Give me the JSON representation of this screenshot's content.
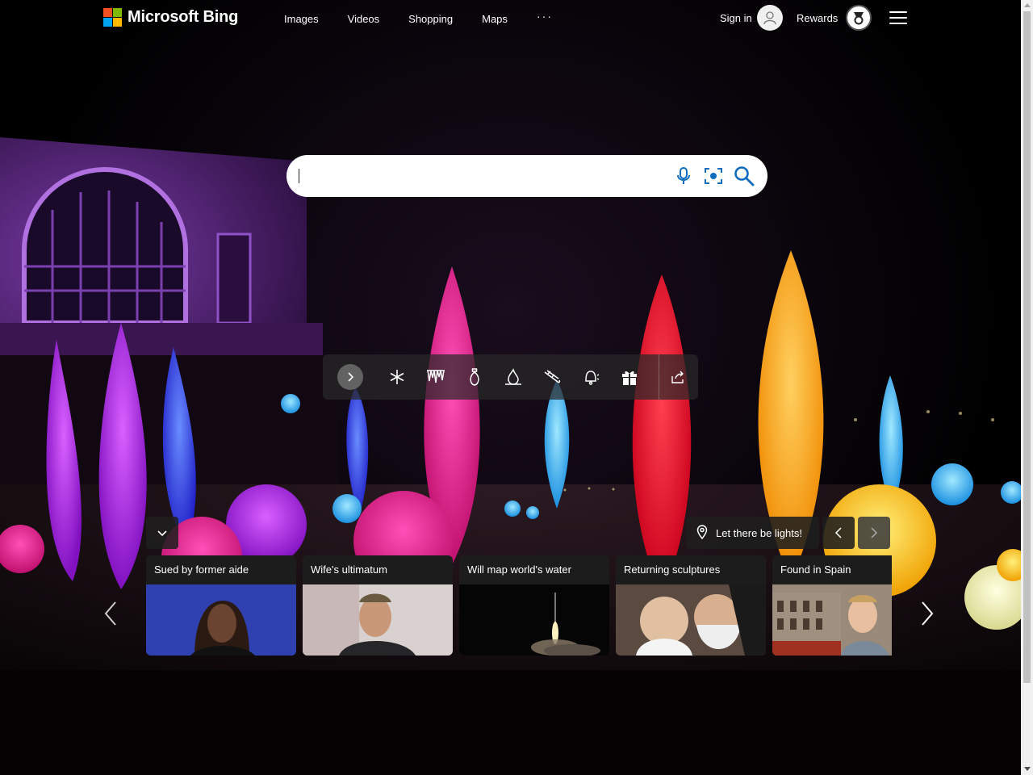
{
  "brand": {
    "name": "Microsoft Bing"
  },
  "nav": {
    "items": [
      "Images",
      "Videos",
      "Shopping",
      "Maps"
    ],
    "more": "···"
  },
  "account": {
    "signin_label": "Sign in",
    "rewards_label": "Rewards"
  },
  "search": {
    "value": "",
    "placeholder": ""
  },
  "image_of_day": {
    "title": "Let there be lights!"
  },
  "cards": [
    {
      "title": "Sued by former aide"
    },
    {
      "title": "Wife's ultimatum"
    },
    {
      "title": "Will map world's water"
    },
    {
      "title": "Returning sculptures"
    },
    {
      "title": "Found in Spain"
    }
  ],
  "colors": {
    "search_icon": "#0f6cbd",
    "toolbar_bg": "#282828",
    "card_title_bg": "#191919"
  },
  "icons": [
    "mic-icon",
    "visual-search-icon",
    "search-icon",
    "snowflake-icon",
    "icicles-icon",
    "ornament-icon",
    "fire-icon",
    "sled-icon",
    "bell-icon",
    "gift-icon",
    "share-icon",
    "location-pin-icon"
  ]
}
